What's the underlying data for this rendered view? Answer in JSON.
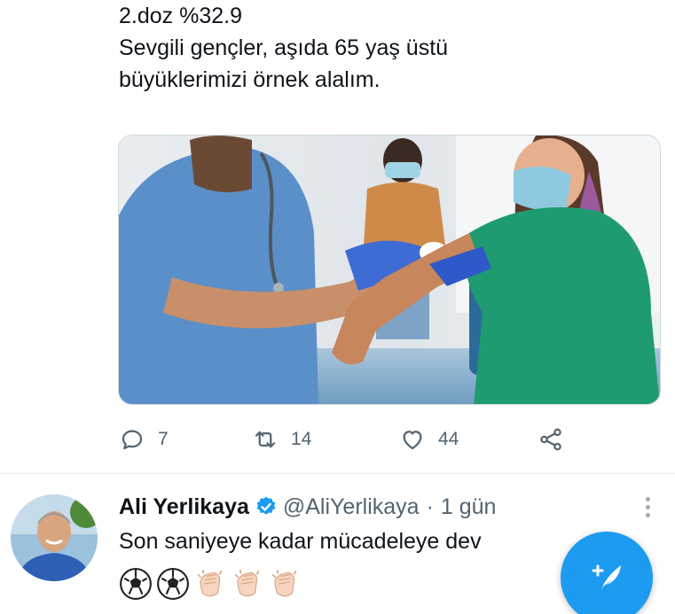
{
  "tweet": {
    "text_lines": [
      "2.doz %32.9",
      "Sevgili gençler, aşıda 65 yaş üstü",
      "büyüklerimizi örnek alalım."
    ],
    "stats": {
      "replies": "7",
      "retweets": "14",
      "likes": "44"
    }
  },
  "next_tweet": {
    "name": "Ali Yerlikaya",
    "handle": "@AliYerlikaya",
    "separator": "·",
    "time": "1 gün",
    "text": "Son saniyeye kadar mücadeleye dev",
    "emojis": [
      "soccer-ball",
      "soccer-ball",
      "clapping-hands",
      "clapping-hands",
      "clapping-hands"
    ]
  },
  "colors": {
    "accent": "#1d9bf0",
    "muted": "#536471",
    "text": "#0f1419"
  },
  "icons": {
    "reply": "speech-bubble",
    "retweet": "retweet-arrows",
    "like": "heart",
    "share": "share-nodes",
    "verified": "verified-badge",
    "compose": "feather-plus"
  }
}
